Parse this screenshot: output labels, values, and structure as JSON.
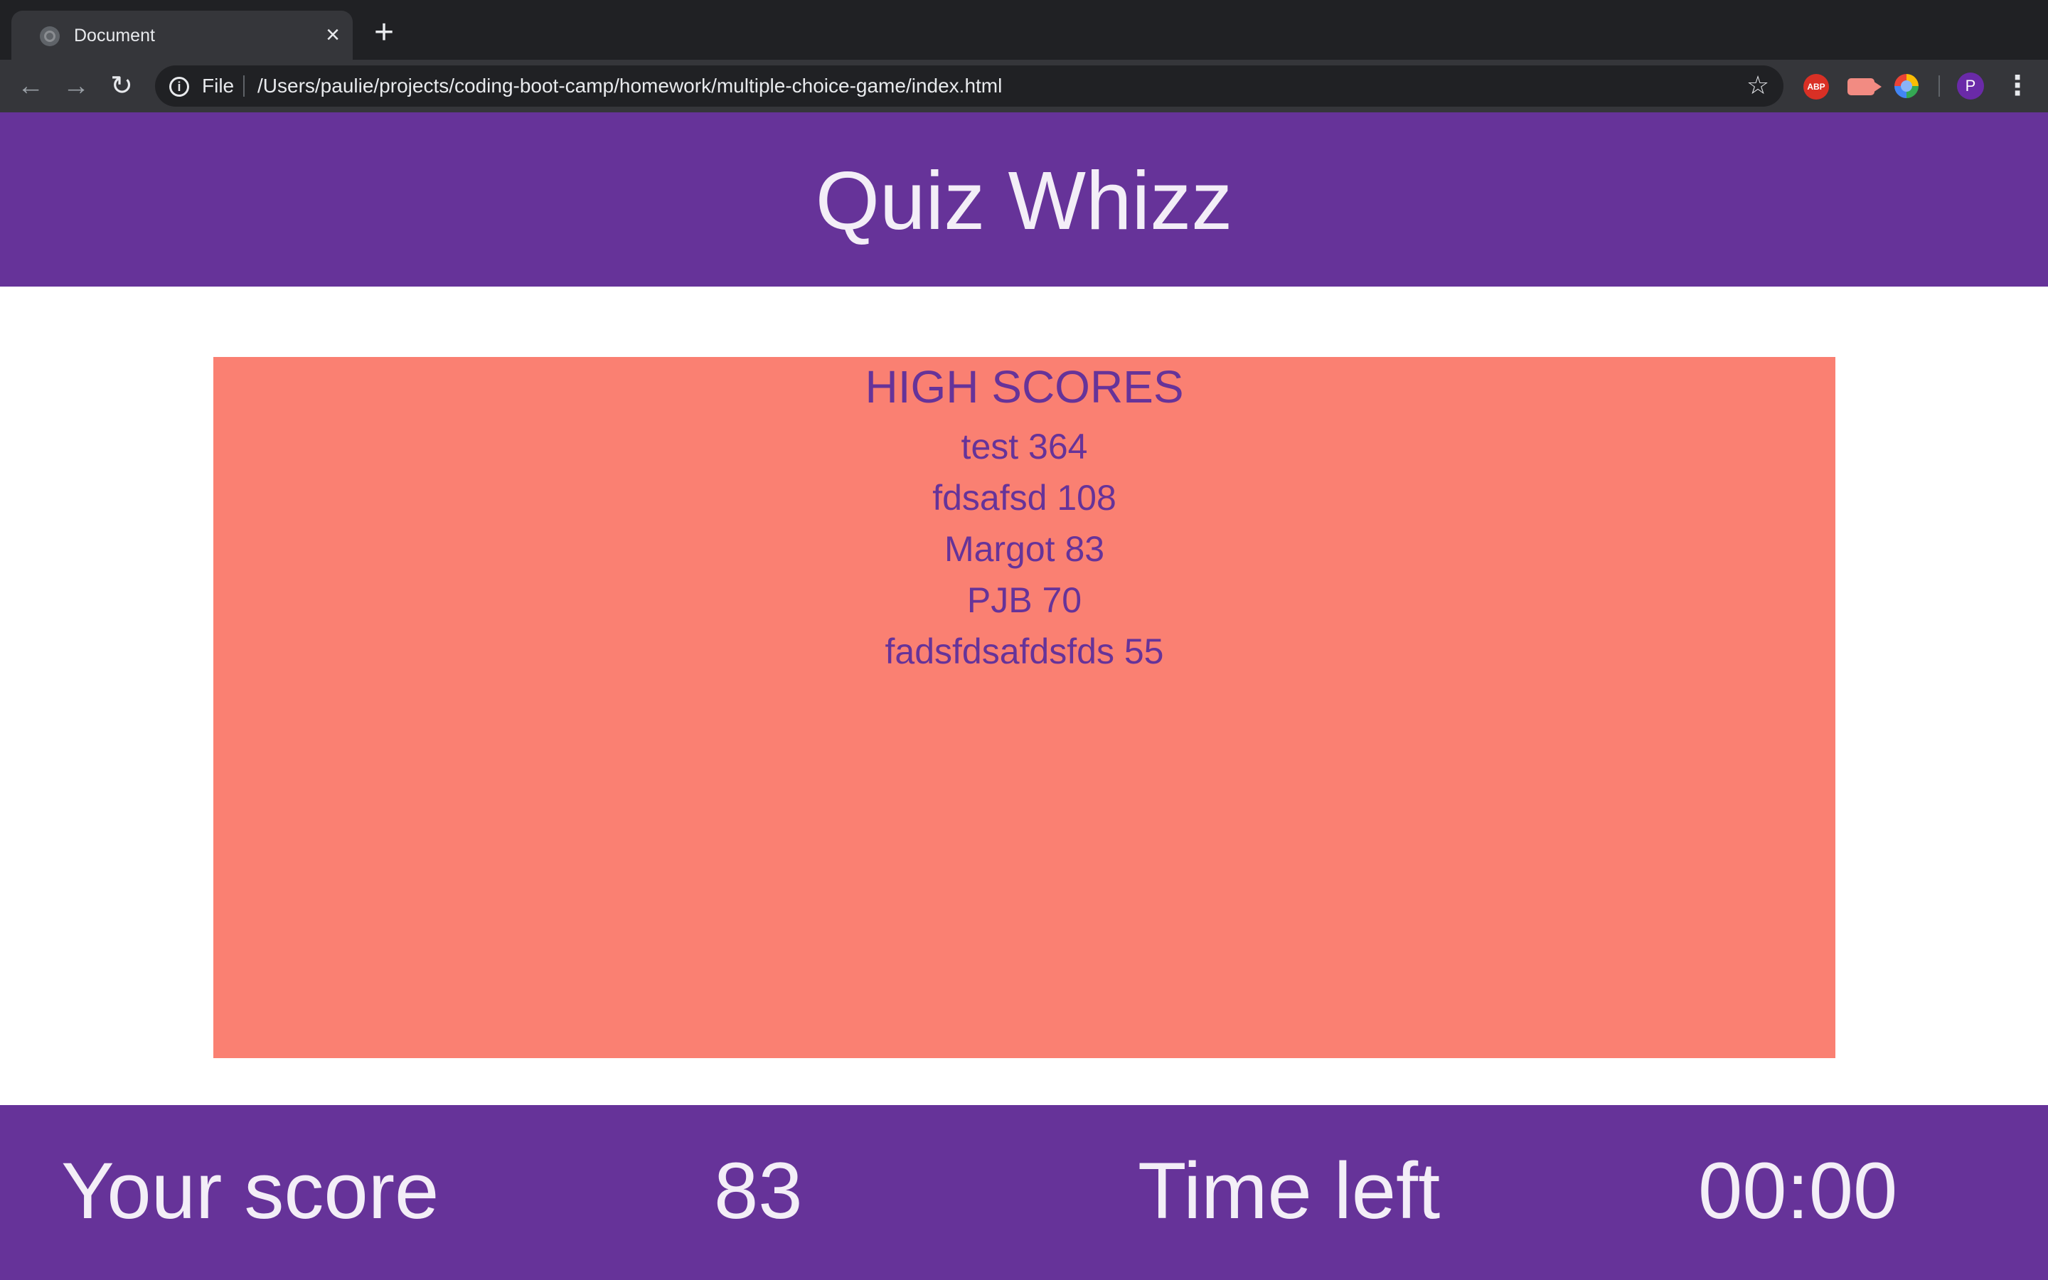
{
  "browser": {
    "tab": {
      "title": "Document",
      "close_glyph": "×"
    },
    "new_tab_glyph": "+",
    "nav": {
      "back_glyph": "←",
      "forward_glyph": "→",
      "reload_glyph": "↻"
    },
    "omnibox": {
      "info_glyph": "i",
      "scheme_label": "File",
      "url": "/Users/paulie/projects/coding-boot-camp/homework/multiple-choice-game/index.html",
      "star_glyph": "☆"
    },
    "extensions": [
      {
        "name": "adblock-plus-icon",
        "label": "ABP"
      },
      {
        "name": "video-extension-icon"
      },
      {
        "name": "globe-extension-icon"
      }
    ],
    "profile_initial": "P",
    "menu_glyph": "⋮"
  },
  "header": {
    "title": "Quiz Whizz"
  },
  "high_scores": {
    "heading": "HIGH SCORES",
    "entries": [
      "test 364",
      "fdsafsd 108",
      "Margot 83",
      "PJB 70",
      "fadsfdsafdsfds 55"
    ]
  },
  "footer": {
    "score_label": "Your score",
    "score_value": "83",
    "time_label": "Time left",
    "time_value": "00:00"
  },
  "colors": {
    "brand_purple": "#663399",
    "panel_salmon": "#fa8072",
    "text_light": "#f3eef7"
  }
}
